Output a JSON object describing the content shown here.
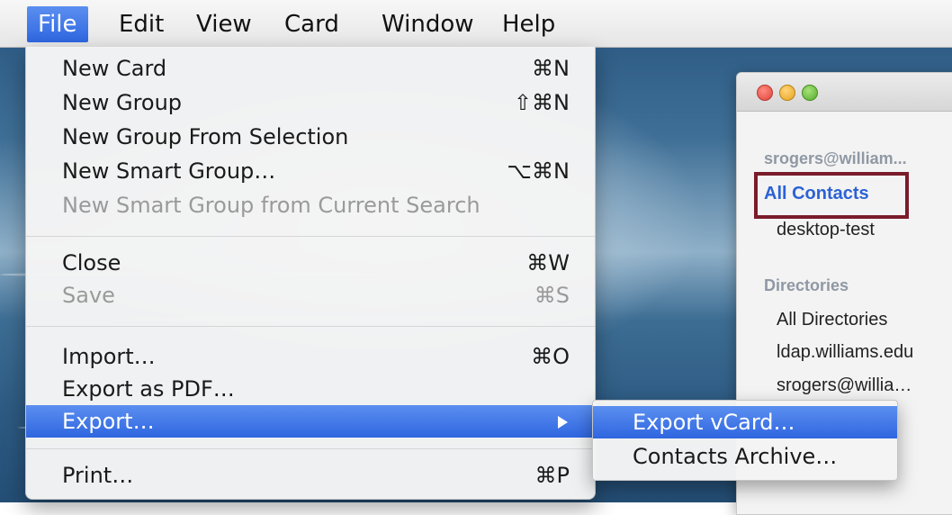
{
  "menubar": {
    "items": [
      {
        "label": "File",
        "active": true
      },
      {
        "label": "Edit"
      },
      {
        "label": "View"
      },
      {
        "label": "Card"
      },
      {
        "label": "Window"
      },
      {
        "label": "Help"
      }
    ]
  },
  "file_menu": {
    "items": [
      {
        "label": "New Card",
        "shortcut": "⌘N"
      },
      {
        "label": "New Group",
        "shortcut": "⇧⌘N"
      },
      {
        "label": "New Group From Selection",
        "shortcut": ""
      },
      {
        "label": "New Smart Group…",
        "shortcut": "⌥⌘N"
      },
      {
        "label": "New Smart Group from Current Search",
        "shortcut": "",
        "disabled": true
      },
      {
        "label": "Close",
        "shortcut": "⌘W"
      },
      {
        "label": "Save",
        "shortcut": "⌘S",
        "disabled": true
      },
      {
        "label": "Import…",
        "shortcut": "⌘O"
      },
      {
        "label": "Export as PDF…",
        "shortcut": ""
      },
      {
        "label": "Export…",
        "shortcut": "",
        "highlighted": true,
        "has_submenu": true
      },
      {
        "label": "Print…",
        "shortcut": "⌘P"
      }
    ]
  },
  "export_submenu": {
    "items": [
      {
        "label": "Export vCard…",
        "highlighted": true
      },
      {
        "label": "Contacts Archive…"
      }
    ]
  },
  "contacts_window": {
    "account_header": "srogers@william...",
    "groups": [
      {
        "label": "All Contacts",
        "selected": true
      },
      {
        "label": "desktop-test"
      }
    ],
    "directories_header": "Directories",
    "directories": [
      {
        "label": "All Directories"
      },
      {
        "label": "ldap.williams.edu"
      },
      {
        "label": "srogers@willia…"
      }
    ]
  },
  "colors": {
    "menu_highlight": "#3a73e6",
    "selection_text": "#2c62d4",
    "annotation_box": "#7a1c2a"
  }
}
